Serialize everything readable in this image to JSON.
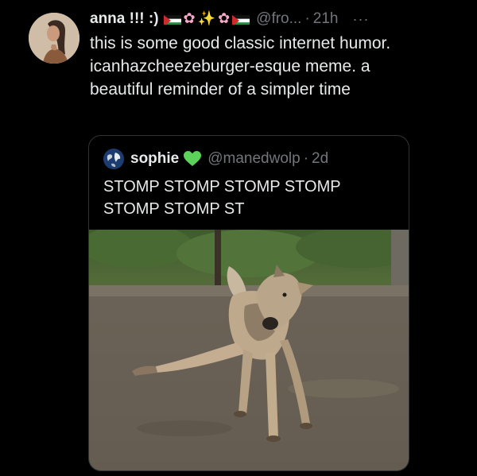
{
  "tweet": {
    "author_name": "anna !!! :)",
    "name_decorations": [
      "palestine-flag",
      "cherry-blossom",
      "sparkles",
      "cherry-blossom",
      "palestine-flag"
    ],
    "handle": "@fro...",
    "separator": "·",
    "time": "21h",
    "more": "···",
    "text": "this is some good classic internet humor. icanhazcheezeburger-esque meme. a beautiful reminder of a simpler time"
  },
  "quote": {
    "author_name": "sophie",
    "badge_icon": "green-heart",
    "handle": "@manedwolp",
    "separator": "·",
    "time": "2d",
    "text": "STOMP STOMP STOMP STOMP STOMP STOMP ST",
    "media": {
      "subject": "wolf-photo"
    }
  },
  "colors": {
    "background": "#000000",
    "text_primary": "#e7e9ea",
    "text_secondary": "#71767b",
    "border": "#2f3336",
    "heart": "#5bd35b"
  },
  "icons": {
    "blossom": "✿",
    "sparkle": "✨"
  }
}
